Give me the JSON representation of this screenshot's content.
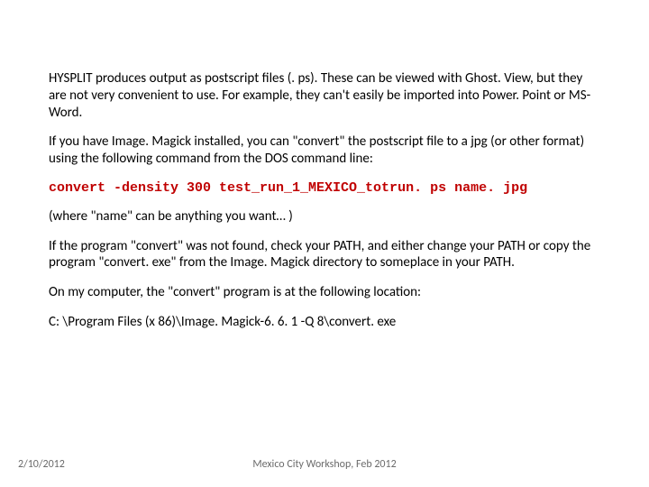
{
  "body": {
    "p1": "HYSPLIT produces output as postscript files (. ps). These can be viewed with Ghost. View, but they are not very convenient to use. For example, they can't easily be imported into Power. Point or MS-Word.",
    "p2": "If you have Image. Magick installed, you can \"convert\" the postscript file to a jpg (or other format) using the following command from the DOS command line:",
    "cmd": "convert -density 300 test_run_1_MEXICO_totrun. ps name. jpg",
    "p3": "(where \"name\" can be anything you want… )",
    "p4": "If the program \"convert\" was not found, check your PATH, and either change your PATH or copy the program \"convert. exe\" from the Image. Magick directory to someplace in your PATH.",
    "p5": "On my computer, the \"convert\" program is at the following location:",
    "p6": "C: \\Program Files (x 86)\\Image. Magick-6. 6. 1 -Q 8\\convert. exe"
  },
  "footer": {
    "date": "2/10/2012",
    "center": "Mexico City Workshop, Feb 2012"
  }
}
